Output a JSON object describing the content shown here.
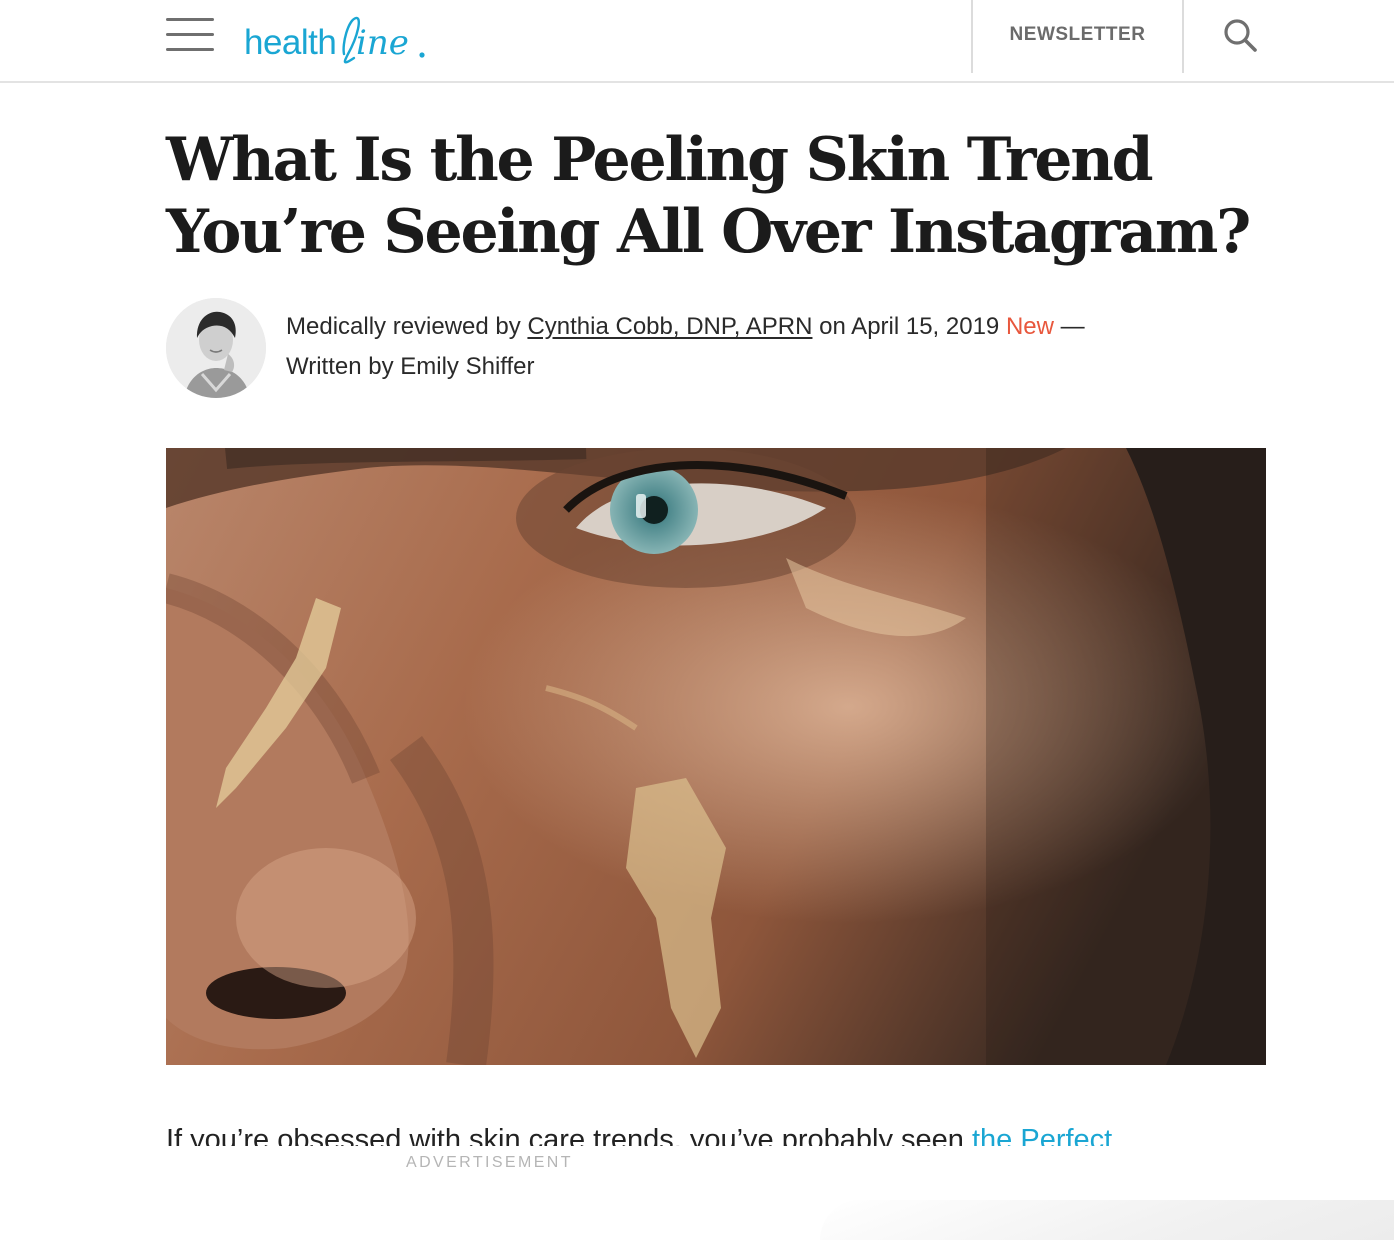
{
  "header": {
    "logo_text": "healthline",
    "newsletter_label": "NEWSLETTER",
    "icons": {
      "menu": "hamburger-menu-icon",
      "search": "search-icon"
    },
    "brand_color": "#1aa6d3"
  },
  "article": {
    "title": "What Is the Peeling Skin Trend You’re Seeing All Over Instagram?",
    "byline": {
      "reviewed_prefix": "Medically reviewed by",
      "reviewer": "Cynthia Cobb, DNP, APRN",
      "date_text": "on April 15, 2019",
      "new_badge": "New",
      "dash": "—",
      "written_by": "Written by Emily Shiffer"
    },
    "intro": {
      "text": "If you’re obsessed with skin care trends, you’ve probably seen",
      "link_text": "the Perfect"
    },
    "accent_new_color": "#e8573d"
  },
  "ad": {
    "label": "ADVERTISEMENT"
  }
}
